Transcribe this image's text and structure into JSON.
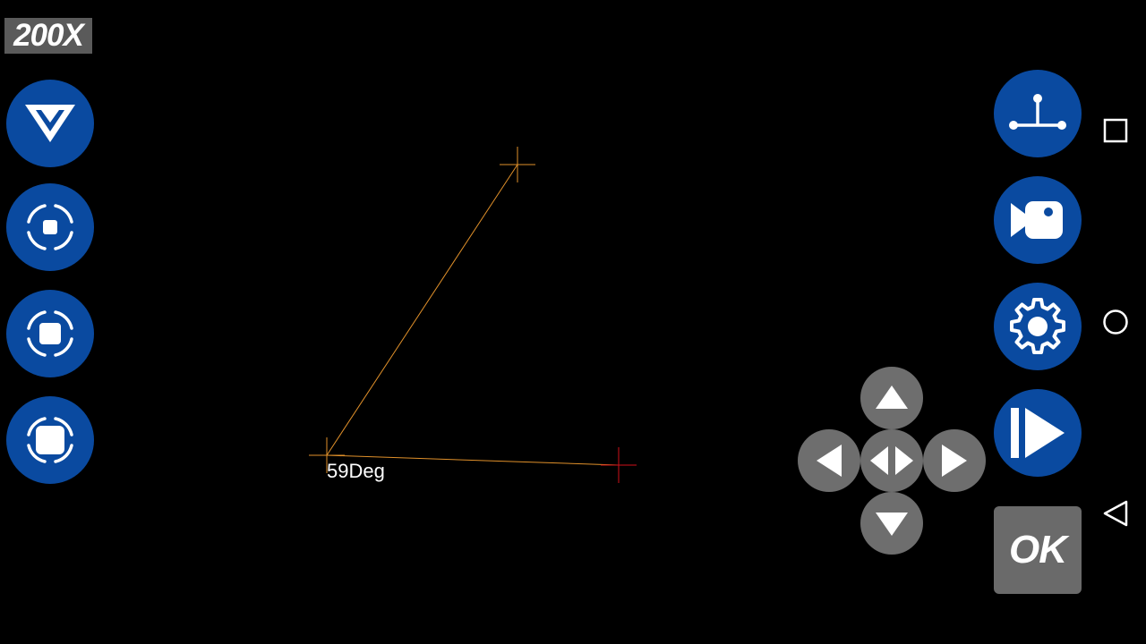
{
  "zoom": {
    "label": "200X"
  },
  "measurement": {
    "angle_label": "59Deg",
    "line_color": "#e0902a",
    "marker_color": "#d0101a"
  },
  "left_toolbar": [
    {
      "name": "collapse-chevron-icon"
    },
    {
      "name": "capture-small-icon"
    },
    {
      "name": "capture-medium-icon"
    },
    {
      "name": "capture-large-icon"
    }
  ],
  "right_toolbar": [
    {
      "name": "angle-measure-icon"
    },
    {
      "name": "video-camera-icon"
    },
    {
      "name": "gear-icon"
    },
    {
      "name": "play-next-icon"
    }
  ],
  "ok_button": {
    "label": "OK"
  },
  "dpad": [
    "arrow-up-icon",
    "arrow-left-icon",
    "arrow-center-icon",
    "arrow-right-icon",
    "arrow-down-icon"
  ],
  "system_nav": [
    "recents-square-icon",
    "home-circle-icon",
    "back-triangle-icon"
  ],
  "colors": {
    "button_blue": "#0a4aa0",
    "ok_gray": "#6a6a6a",
    "dpad_gray": "#6e6e6e"
  }
}
